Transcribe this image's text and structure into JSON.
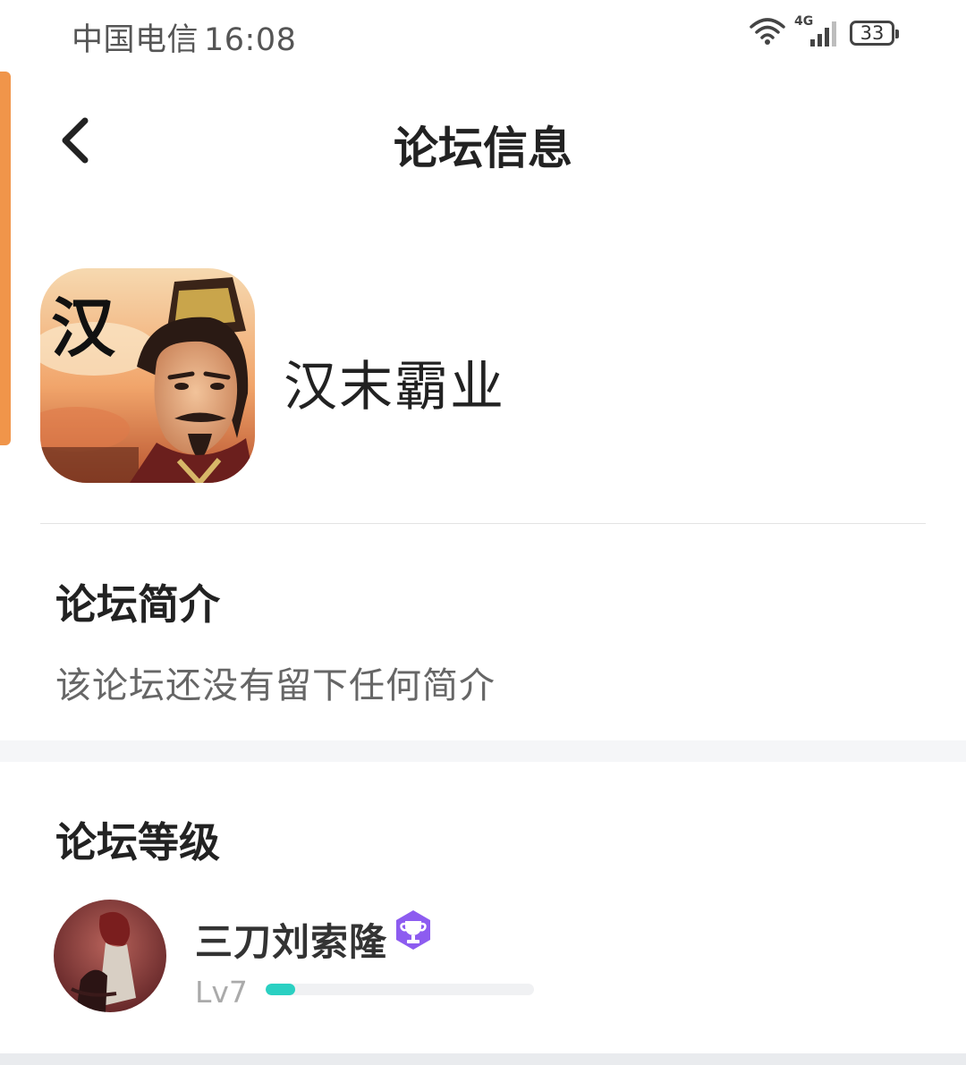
{
  "status_bar": {
    "carrier": "中国电信",
    "time": "16:08",
    "network": "4G",
    "battery": "33"
  },
  "nav": {
    "title": "论坛信息"
  },
  "forum": {
    "name": "汉末霸业",
    "icon_glyph": "汉"
  },
  "intro": {
    "title": "论坛简介",
    "text": "该论坛还没有留下任何简介"
  },
  "level_section": {
    "title": "论坛等级",
    "user": {
      "name": "三刀刘索隆",
      "level": "Lv7",
      "progress_fraction": 0.11
    }
  },
  "colors": {
    "accent_orange": "#f0954a",
    "progress_teal": "#2ad0c2",
    "badge_purple": "#8d5cf0"
  }
}
